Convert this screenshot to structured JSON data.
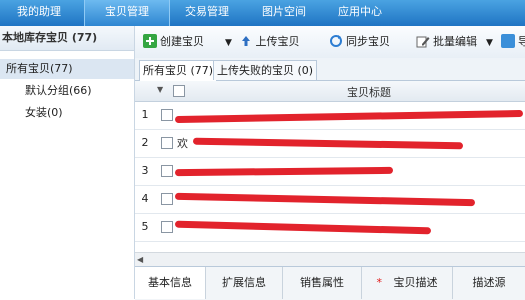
{
  "topnav": {
    "tabs": [
      "我的助理",
      "宝贝管理",
      "交易管理",
      "图片空间",
      "应用中心"
    ]
  },
  "sidebar": {
    "title": "本地库存宝贝 (77)",
    "items": [
      {
        "label": "所有宝贝(77)"
      },
      {
        "label": "默认分组(66)"
      },
      {
        "label": "女装(0)"
      }
    ]
  },
  "toolbar": {
    "create": "创建宝贝",
    "upload": "上传宝贝",
    "sync": "同步宝贝",
    "batch_edit": "批量编辑",
    "import_partial": "导"
  },
  "subtabs": [
    "所有宝贝 (77)",
    "上传失败的宝贝 (0)"
  ],
  "table": {
    "column_title": "宝贝标题",
    "rows": [
      {
        "num": "1",
        "title": ""
      },
      {
        "num": "2",
        "title": "欢"
      },
      {
        "num": "3",
        "title": ""
      },
      {
        "num": "4",
        "title": ""
      },
      {
        "num": "5",
        "title": ""
      }
    ]
  },
  "bottom_tabs": [
    "基本信息",
    "扩展信息",
    "销售属性",
    "宝贝描述",
    "描述源"
  ],
  "bottom_star": "*",
  "colors": {
    "nav": "#1f74c3",
    "redaction": "#e0101a"
  }
}
